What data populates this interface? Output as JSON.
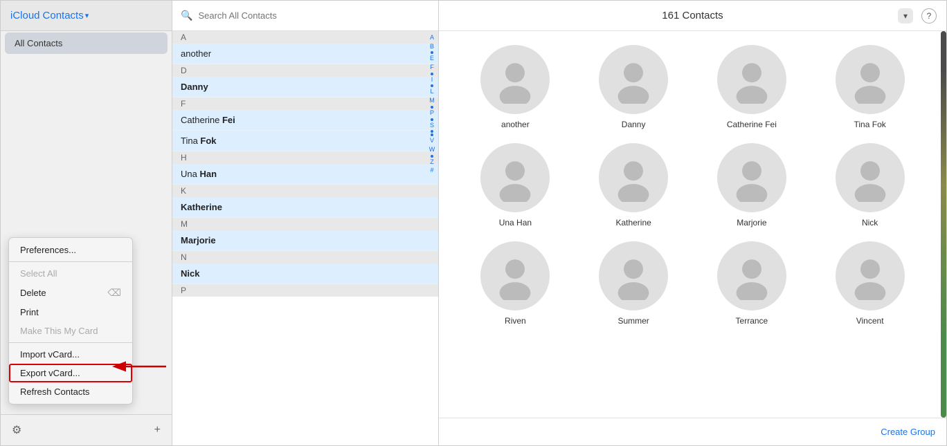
{
  "app": {
    "title_icloud": "iCloud",
    "title_contacts": "Contacts",
    "chevron": "▾"
  },
  "sidebar": {
    "all_contacts_label": "All Contacts",
    "gear_icon": "⚙",
    "plus_icon": "+"
  },
  "search": {
    "placeholder": "Search All Contacts"
  },
  "contact_list": {
    "sections": [
      {
        "letter": "A",
        "contacts": [
          {
            "first": "another",
            "last": "",
            "display": "another"
          }
        ]
      },
      {
        "letter": "D",
        "contacts": [
          {
            "first": "Danny",
            "last": "",
            "display": "Danny"
          }
        ]
      },
      {
        "letter": "F",
        "contacts": [
          {
            "first": "Catherine",
            "last": "Fei",
            "display": "Catherine Fei"
          },
          {
            "first": "Tina",
            "last": "Fok",
            "display": "Tina Fok"
          }
        ]
      },
      {
        "letter": "H",
        "contacts": [
          {
            "first": "Una",
            "last": "Han",
            "display": "Una Han"
          }
        ]
      },
      {
        "letter": "K",
        "contacts": [
          {
            "first": "Katherine",
            "last": "",
            "display": "Katherine"
          }
        ]
      },
      {
        "letter": "M",
        "contacts": [
          {
            "first": "Marjorie",
            "last": "",
            "display": "Marjorie"
          }
        ]
      },
      {
        "letter": "N",
        "contacts": [
          {
            "first": "Nick",
            "last": "",
            "display": "Nick"
          }
        ]
      }
    ]
  },
  "alpha_index": [
    "A",
    "B",
    "•",
    "E",
    "F",
    "•",
    "I",
    "•",
    "L",
    "M",
    "•",
    "P",
    "•",
    "S",
    "•",
    "•",
    "V",
    "W",
    "•",
    "Z",
    "#"
  ],
  "header": {
    "contacts_count": "161 Contacts",
    "sort_label": "",
    "help_label": "?"
  },
  "contacts_grid": [
    {
      "name": "another"
    },
    {
      "name": "Danny"
    },
    {
      "name": "Catherine Fei"
    },
    {
      "name": "Tina Fok"
    },
    {
      "name": "Una Han"
    },
    {
      "name": "Katherine"
    },
    {
      "name": "Marjorie"
    },
    {
      "name": "Nick"
    },
    {
      "name": "Riven"
    },
    {
      "name": "Summer"
    },
    {
      "name": "Terrance"
    },
    {
      "name": "Vincent"
    }
  ],
  "footer": {
    "create_group_label": "Create Group"
  },
  "context_menu": {
    "items": [
      {
        "label": "Preferences...",
        "disabled": false,
        "key": "preferences"
      },
      {
        "label": "Select All",
        "disabled": false,
        "key": "select-all"
      },
      {
        "label": "Delete",
        "disabled": false,
        "key": "delete",
        "shortcut": "⌫"
      },
      {
        "label": "Print",
        "disabled": false,
        "key": "print"
      },
      {
        "label": "Make This My Card",
        "disabled": false,
        "key": "make-my-card"
      },
      {
        "label": "Import vCard...",
        "disabled": false,
        "key": "import-vcard"
      },
      {
        "label": "Export vCard...",
        "disabled": false,
        "key": "export-vcard",
        "highlighted": true
      },
      {
        "label": "Refresh Contacts",
        "disabled": false,
        "key": "refresh"
      }
    ]
  }
}
